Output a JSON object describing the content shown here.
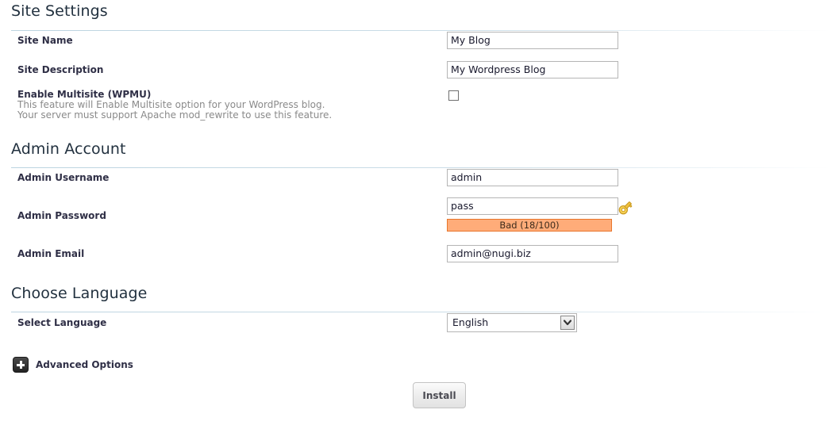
{
  "sections": {
    "site_settings": {
      "heading": "Site Settings",
      "fields": {
        "site_name": {
          "label": "Site Name",
          "value": "My Blog"
        },
        "site_description": {
          "label": "Site Description",
          "value": "My Wordpress Blog"
        },
        "multisite": {
          "label": "Enable Multisite (WPMU)",
          "desc_line1": "This feature will Enable Multisite option for your WordPress blog.",
          "desc_line2": "Your server must support Apache mod_rewrite to use this feature.",
          "checked": false
        }
      }
    },
    "admin_account": {
      "heading": "Admin Account",
      "fields": {
        "admin_username": {
          "label": "Admin Username",
          "value": "admin"
        },
        "admin_password": {
          "label": "Admin Password",
          "value": "pass",
          "strength_text": "Bad (18/100)",
          "strength_score": 18,
          "strength_max": 100,
          "strength_level": "Bad",
          "generate_icon": "key-icon"
        },
        "admin_email": {
          "label": "Admin Email",
          "value": "admin@nugi.biz"
        }
      }
    },
    "choose_language": {
      "heading": "Choose Language",
      "fields": {
        "select_language": {
          "label": "Select Language",
          "value": "English",
          "dropdown_icon": "chevron-down-icon"
        }
      }
    }
  },
  "advanced_options": {
    "label": "Advanced Options",
    "toggle_icon": "plus-square-icon",
    "expanded": false
  },
  "actions": {
    "install_label": "Install"
  },
  "colors": {
    "heading": "#22313f",
    "rule": "#bcd4e0",
    "label": "#2f2f46",
    "description": "#8a8a8a",
    "input_border": "#b5b5b5",
    "strength_fill": "#ffac79",
    "strength_border": "#e8762c",
    "key_icon": "#f5c842",
    "advanced_icon": "#232323",
    "button_text": "#4a4a52"
  }
}
